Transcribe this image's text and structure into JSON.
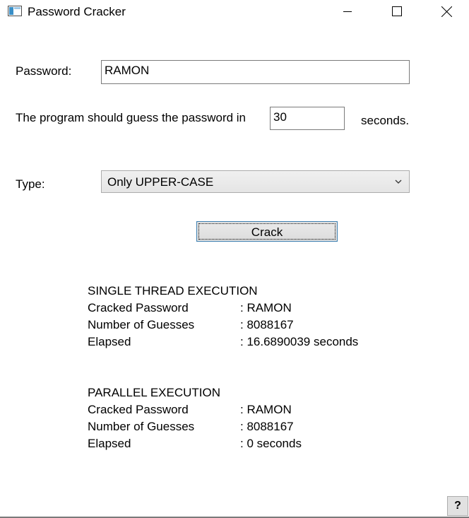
{
  "window": {
    "title": "Password Cracker"
  },
  "form": {
    "password_label": "Password:",
    "password_value": "RAMON",
    "time_prefix": "The program should guess the password in",
    "time_value": "30",
    "time_suffix": "seconds.",
    "type_label": "Type:",
    "type_selected": "Only UPPER-CASE",
    "crack_button": "Crack"
  },
  "single": {
    "heading": "SINGLE THREAD EXECUTION",
    "rows": [
      {
        "key": "Cracked Password",
        "value": ": RAMON"
      },
      {
        "key": "Number of Guesses",
        "value": ": 8088167"
      },
      {
        "key": "Elapsed",
        "value": ": 16.6890039 seconds"
      }
    ]
  },
  "parallel": {
    "heading": "PARALLEL EXECUTION",
    "rows": [
      {
        "key": "Cracked Password",
        "value": ": RAMON"
      },
      {
        "key": "Number of Guesses",
        "value": ": 8088167"
      },
      {
        "key": "Elapsed",
        "value": ": 0 seconds"
      }
    ]
  },
  "help_button": "?"
}
